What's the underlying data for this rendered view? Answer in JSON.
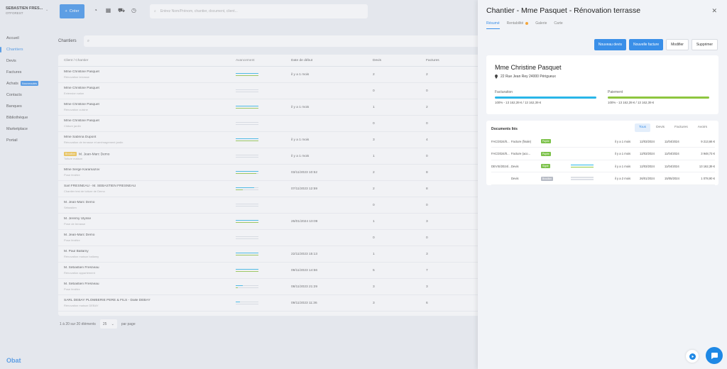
{
  "user": {
    "name": "SÉBASTIEN FRES...",
    "company": "OTFOREST"
  },
  "topbar": {
    "create_label": "Créer",
    "search_placeholder": "Entrez Nom/Prénom, chantier, document, client..."
  },
  "sidebar": {
    "items": [
      {
        "label": "Accueil"
      },
      {
        "label": "Chantiers"
      },
      {
        "label": "Devis"
      },
      {
        "label": "Factures"
      },
      {
        "label": "Achats",
        "badge": "Nouveautés"
      },
      {
        "label": "Contacts"
      },
      {
        "label": "Banques"
      },
      {
        "label": "Bibliothèque"
      },
      {
        "label": "Marketplace"
      },
      {
        "label": "Portail"
      }
    ],
    "brand": "Obat"
  },
  "list": {
    "title": "Chantiers",
    "columns": [
      "Client / Chantier",
      "Avancement",
      "Date de début",
      "Devis",
      "Factures"
    ],
    "rows": [
      {
        "client": "Mme Christine Pasquet",
        "sub": "Rénovation terrasse",
        "date": "il y a 1 mois",
        "devis": "2",
        "factures": "2",
        "prog": [
          1.0,
          1.0
        ],
        "tag": ""
      },
      {
        "client": "Mme Christine Pasquet",
        "sub": "Extension salon",
        "date": "",
        "devis": "0",
        "factures": "0",
        "prog": [
          0,
          0
        ],
        "tag": ""
      },
      {
        "client": "Mme Christine Pasquet",
        "sub": "Rénovation cuisine",
        "date": "il y a 1 mois",
        "devis": "1",
        "factures": "2",
        "prog": [
          1.0,
          1.0
        ],
        "tag": ""
      },
      {
        "client": "Mme Christine Pasquet",
        "sub": "Clôture jardin",
        "date": "",
        "devis": "0",
        "factures": "0",
        "prog": [
          0,
          0
        ],
        "tag": ""
      },
      {
        "client": "Mme Sabrina Dupont",
        "sub": "Rénovation de terrasse et aménagement jardin",
        "date": "il y a 1 mois",
        "devis": "3",
        "factures": "4",
        "prog": [
          1.0,
          1.0
        ],
        "tag": ""
      },
      {
        "client": "M. Jean-Marc Demo",
        "sub": "Toiture maison",
        "date": "il y a 1 mois",
        "devis": "1",
        "factures": "0",
        "prog": [
          0,
          0
        ],
        "tag": "Brouillon"
      },
      {
        "client": "Mme Serge Karamazov",
        "sub": "Pose fenêtre",
        "date": "03/11/2023 10:52",
        "devis": "2",
        "factures": "8",
        "prog": [
          1.0,
          0.9
        ],
        "tag": ""
      },
      {
        "client": "Sarl FRESNEAU - M. SÉBASTIEN FRESNEAU",
        "sub": "Chantier test de toiture de Demo",
        "date": "07/11/2023 12:59",
        "devis": "2",
        "factures": "8",
        "prog": [
          0.8,
          0.3
        ],
        "tag": ""
      },
      {
        "client": "M. Jean-Marc Demo",
        "sub": "Sébastien",
        "date": "",
        "devis": "0",
        "factures": "0",
        "prog": [
          0,
          0
        ],
        "tag": ""
      },
      {
        "client": "M. Jeremy Ulysse",
        "sub": "Pose de terrasse",
        "date": "26/01/2024 10:09",
        "devis": "1",
        "factures": "3",
        "prog": [
          1.0,
          1.0
        ],
        "tag": ""
      },
      {
        "client": "M. Jean-Marc Demo",
        "sub": "Pose fenêtre",
        "date": "",
        "devis": "0",
        "factures": "0",
        "prog": [
          0,
          0
        ],
        "tag": ""
      },
      {
        "client": "M. Paul Ballamy",
        "sub": "Rénovation maison ballamy",
        "date": "22/11/2023 15:13",
        "devis": "1",
        "factures": "3",
        "prog": [
          1.0,
          1.0
        ],
        "tag": ""
      },
      {
        "client": "M. Sébastien Fresneau",
        "sub": "Rénovation appartement",
        "date": "09/11/2023 14:56",
        "devis": "5",
        "factures": "7",
        "prog": [
          1.0,
          1.0
        ],
        "tag": ""
      },
      {
        "client": "M. Sébastien Fresneau",
        "sub": "Pose fenêtre",
        "date": "08/11/2023 21:29",
        "devis": "3",
        "factures": "3",
        "prog": [
          0.3,
          0.1
        ],
        "tag": ""
      },
      {
        "client": "SARL DEBAY PLOMBERIE PERE & FILS - Dalle DEBAY",
        "sub": "Rénovation maison DEBAY",
        "date": "09/11/2023 11:36",
        "devis": "3",
        "factures": "6",
        "prog": [
          0.2,
          0
        ],
        "tag": ""
      }
    ],
    "pager": {
      "range": "1 à 20 sur 20 éléments",
      "per_page": "25",
      "per_page_label": "par page"
    }
  },
  "drawer": {
    "title": "Chantier - Mme Pasquet - Rénovation terrasse",
    "tabs": [
      "Résumé",
      "Rentabilité",
      "Galerie",
      "Carte"
    ],
    "actions": {
      "new_quote": "Nouveau devis",
      "new_invoice": "Nouvelle facture",
      "edit": "Modifier",
      "delete": "Supprimer"
    },
    "client": {
      "name": "Mme Christine Pasquet",
      "address": "22 Rue Jean Rey 24000 Périgueux",
      "billing_label": "Facturation",
      "billing_value": "100% - 13 162,39 € / 13 162,39 €",
      "billing_progress": 1.0,
      "payment_label": "Paiement",
      "payment_value": "100% - 13 162,39 € / 13 162,39 €",
      "payment_progress": 1.0
    },
    "docs": {
      "title": "Documents liés",
      "tabs": [
        "Tous",
        "Devis",
        "Factures",
        "Avoirs"
      ],
      "rows": [
        {
          "num": "FAC/2024/0...",
          "type": "Facture (finale)",
          "status": "Payée",
          "status_color": "green",
          "prog": [],
          "ago": "il y a 1 mois",
          "d1": "12/03/2024",
          "d2": "11/04/2024",
          "amount": "9 213,66 €"
        },
        {
          "num": "FAC/2024/0...",
          "type": "Facture (aco...",
          "status": "Payée",
          "status_color": "green",
          "prog": [],
          "ago": "il y a 1 mois",
          "d1": "12/03/2024",
          "d2": "11/04/2024",
          "amount": "3 948,73 €"
        },
        {
          "num": "DEVIS/2024/...",
          "type": "Devis",
          "status": "Signé",
          "status_color": "green",
          "prog": [
            1.0,
            1.0
          ],
          "ago": "il y a 1 mois",
          "d1": "12/03/2024",
          "d2": "11/04/2024",
          "amount": "13 162,39 €"
        },
        {
          "num": "",
          "type": "Devis",
          "status": "Brouillon",
          "status_color": "grey",
          "prog": [
            0,
            0
          ],
          "ago": "il y a 2 mois",
          "d1": "26/01/2024",
          "d2": "15/05/2024",
          "amount": "1 078,90 €"
        }
      ]
    }
  },
  "colors": {
    "accent": "#3a8fe8",
    "cyan": "#29b6e8",
    "green": "#8ec63f"
  }
}
